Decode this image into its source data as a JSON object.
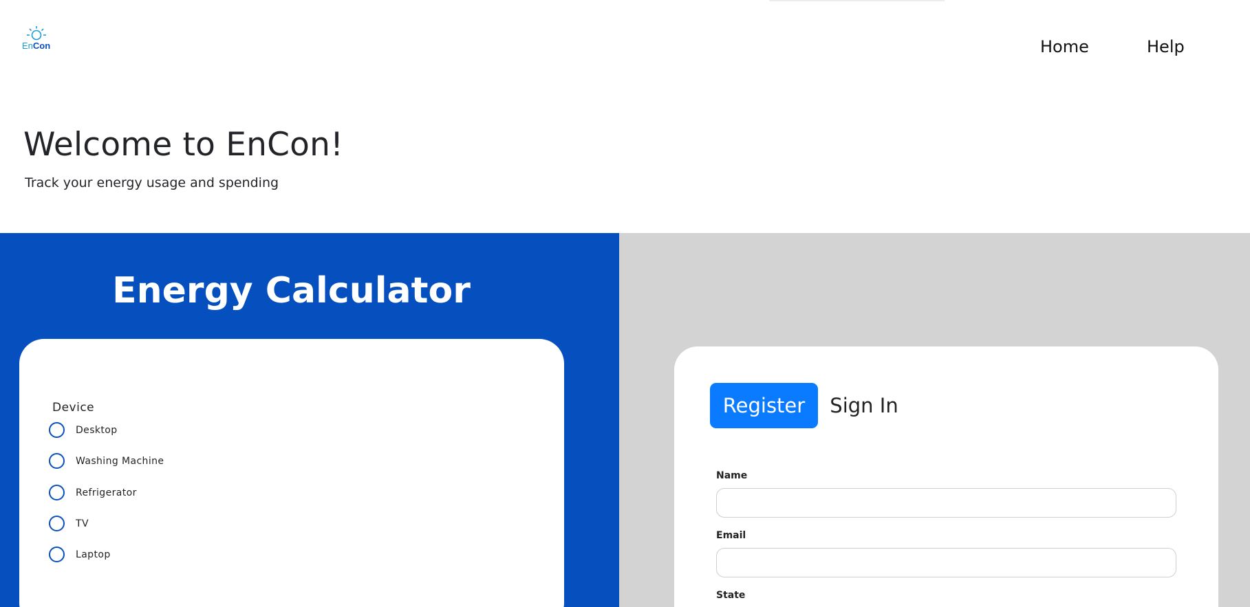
{
  "header": {
    "logo": {
      "text_en": "En",
      "text_con": "Con",
      "icon": "sun-icon"
    },
    "nav": {
      "home": "Home",
      "help": "Help"
    }
  },
  "hero": {
    "title": "Welcome to EnCon!",
    "subtitle": "Track your energy usage and spending"
  },
  "calculator": {
    "title": "Energy Calculator",
    "device_label": "Device",
    "devices": [
      "Desktop",
      "Washing Machine",
      "Refrigerator",
      "TV",
      "Laptop"
    ]
  },
  "auth": {
    "tabs": {
      "register": "Register",
      "sign_in": "Sign In"
    },
    "active_tab": "Register",
    "fields": {
      "name": {
        "label": "Name",
        "value": "",
        "placeholder": ""
      },
      "email": {
        "label": "Email",
        "value": "",
        "placeholder": ""
      },
      "state": {
        "label": "State"
      }
    }
  },
  "colors": {
    "brand_blue": "#054fbe",
    "tab_active": "#0a7bff",
    "panel_gray": "#d3d3d3",
    "logo_light": "#1a9bd8"
  }
}
